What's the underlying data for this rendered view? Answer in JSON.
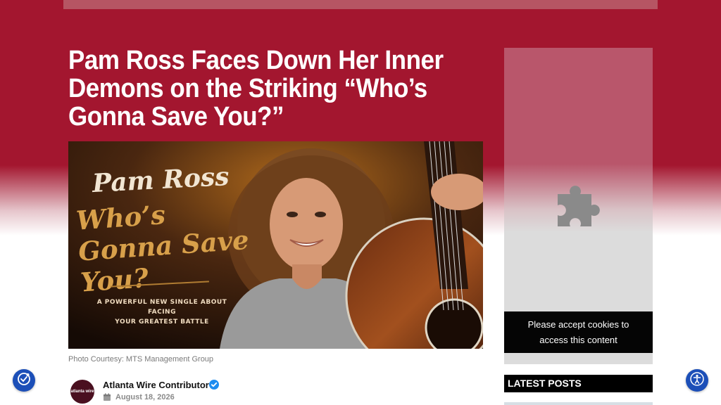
{
  "article": {
    "headline": "Pam Ross Faces Down Her Inner Demons on the Striking “Who’s Gonna Save You?”",
    "caption": "Photo Courtesy: MTS Management Group"
  },
  "hero_image": {
    "artist_name": "Pam Ross",
    "song_title": "Who’s Gonna Save You?",
    "tagline_line1": "A POWERFUL NEW SINGLE ABOUT FACING",
    "tagline_line2": "YOUR GREATEST BATTLE",
    "accent": "#d8a04a"
  },
  "author": {
    "avatar_text": "atlanta wire",
    "name": "Atlanta Wire Contributor",
    "date": "August 18, 2026"
  },
  "sidebar": {
    "cookie_notice": "Please accept cookies to access this content",
    "latest_posts_label": "LATEST POSTS"
  },
  "icons": {
    "consent": "consent-icon",
    "accessibility": "accessibility-icon",
    "placeholder": "puzzle-icon",
    "verified": "verified-icon",
    "calendar": "calendar-icon"
  },
  "colors": {
    "brand": "#a3162f",
    "float_button": "#1c4fb8",
    "verified": "#1d8cf0"
  }
}
